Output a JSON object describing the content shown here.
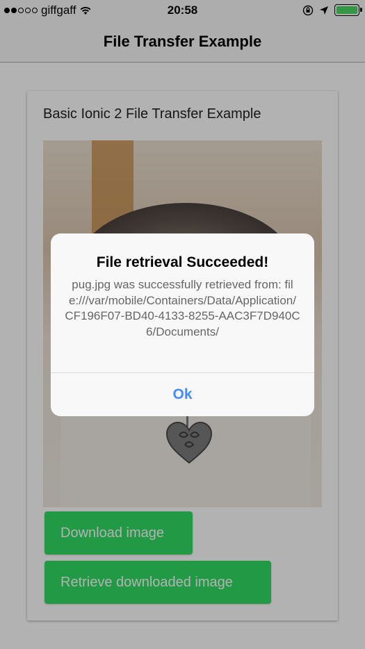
{
  "status_bar": {
    "carrier": "giffgaff",
    "time": "20:58",
    "signal_full_dots": 2,
    "signal_total_dots": 5
  },
  "nav": {
    "title": "File Transfer Example"
  },
  "card": {
    "title": "Basic Ionic 2 File Transfer Example",
    "buttons": {
      "download_label": "Download image",
      "retrieve_label": "Retrieve downloaded image"
    }
  },
  "alert": {
    "title": "File retrieval Succeeded!",
    "message": "pug.jpg was successfully retrieved from: file:///var/mobile/Containers/Data/Application/CF196F07-BD40-4133-8255-AAC3F7D940C6/Documents/",
    "ok_label": "Ok"
  },
  "colors": {
    "primary_button": "#32db64",
    "alert_button_text": "#488aff",
    "battery_fill": "#4cd964"
  },
  "icons": [
    "signal-dots-icon",
    "wifi-icon",
    "orientation-lock-icon",
    "location-arrow-icon",
    "battery-icon"
  ]
}
